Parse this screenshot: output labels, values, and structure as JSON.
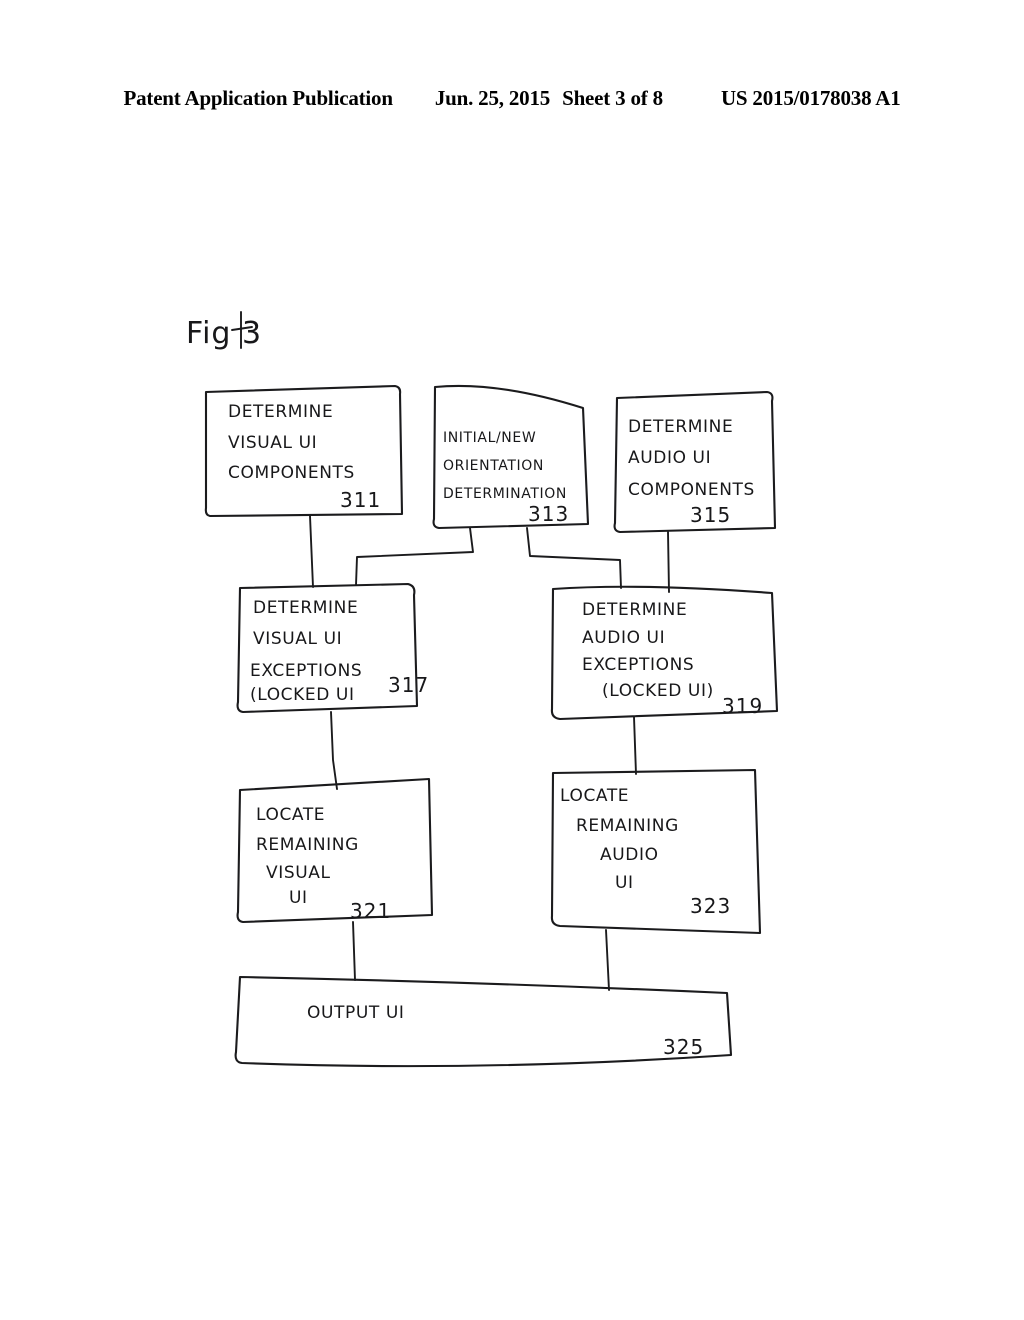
{
  "header": {
    "publication_label": "Patent Application Publication",
    "date": "Jun. 25, 2015",
    "sheet": "Sheet 3 of 8",
    "patent_number": "US 2015/0178038 A1"
  },
  "figure": {
    "label": "Fig 3"
  },
  "diagram": {
    "type": "flowchart",
    "nodes": [
      {
        "id": "311",
        "ref": "311",
        "lines": [
          "DETERMINE",
          "VISUAL UI",
          "COMPONENTS"
        ],
        "line1": "DETERMINE",
        "line2": "VISUAL UI",
        "line3": "COMPONENTS"
      },
      {
        "id": "313",
        "ref": "313",
        "lines": [
          "INITIAL/NEW",
          "ORIENTATION",
          "DETERMINATION"
        ],
        "line1": "INITIAL/NEW",
        "line2": "ORIENTATION",
        "line3": "DETERMINATION"
      },
      {
        "id": "315",
        "ref": "315",
        "lines": [
          "DETERMINE",
          "AUDIO UI",
          "COMPONENTS"
        ],
        "line1": "DETERMINE",
        "line2": "AUDIO UI",
        "line3": "COMPONENTS"
      },
      {
        "id": "317",
        "ref": "317",
        "lines": [
          "DETERMINE",
          "VISUAL UI",
          "EXCEPTIONS",
          "(LOCKED UI"
        ],
        "line1": "DETERMINE",
        "line2": "VISUAL UI",
        "line3": "EXCEPTIONS",
        "line4": "(LOCKED UI"
      },
      {
        "id": "319",
        "ref": "319",
        "lines": [
          "DETERMINE",
          "AUDIO UI",
          "EXCEPTIONS",
          "(LOCKED UI)"
        ],
        "line1": "DETERMINE",
        "line2": "AUDIO UI",
        "line3": "EXCEPTIONS",
        "line4": "(LOCKED UI)"
      },
      {
        "id": "321",
        "ref": "321",
        "lines": [
          "LOCATE",
          "REMAINING",
          "VISUAL",
          "UI"
        ],
        "line1": "LOCATE",
        "line2": "REMAINING",
        "line3": "VISUAL",
        "line4": "UI"
      },
      {
        "id": "323",
        "ref": "323",
        "lines": [
          "LOCATE",
          "REMAINING",
          "AUDIO",
          "UI"
        ],
        "line1": "LOCATE",
        "line2": "REMAINING",
        "line3": "AUDIO",
        "line4": "UI"
      },
      {
        "id": "325",
        "ref": "325",
        "lines": [
          "OUTPUT   UI"
        ],
        "line1": "OUTPUT   UI"
      }
    ],
    "edges": [
      {
        "from": "311",
        "to": "317"
      },
      {
        "from": "313",
        "to": "317"
      },
      {
        "from": "313",
        "to": "319"
      },
      {
        "from": "315",
        "to": "319"
      },
      {
        "from": "317",
        "to": "321"
      },
      {
        "from": "319",
        "to": "323"
      },
      {
        "from": "321",
        "to": "325"
      },
      {
        "from": "323",
        "to": "325"
      }
    ]
  },
  "colors": {
    "ink": "#1b1b1d",
    "page": "#ffffff"
  }
}
